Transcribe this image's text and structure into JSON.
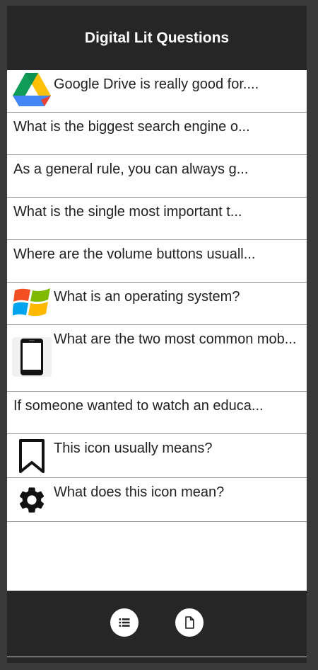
{
  "header": {
    "title": "Digital Lit Questions"
  },
  "questions": [
    {
      "text": "Google Drive is really good for...."
    },
    {
      "text": "What is the biggest search engine o..."
    },
    {
      "text": "As a general rule, you can always g..."
    },
    {
      "text": "What is the single most important t..."
    },
    {
      "text": "Where are the volume buttons usuall..."
    },
    {
      "text": "What is an operating system?"
    },
    {
      "text": "What are the two most common mob..."
    },
    {
      "text": "If someone wanted to watch an educa..."
    },
    {
      "text": "This icon usually means?"
    },
    {
      "text": "What does this icon mean?"
    }
  ],
  "footer": {
    "list_icon": "list-icon",
    "page_icon": "document-icon"
  },
  "colors": {
    "app_bg": "#262626",
    "list_bg": "#ffffff",
    "divider": "#8e8e8e"
  }
}
